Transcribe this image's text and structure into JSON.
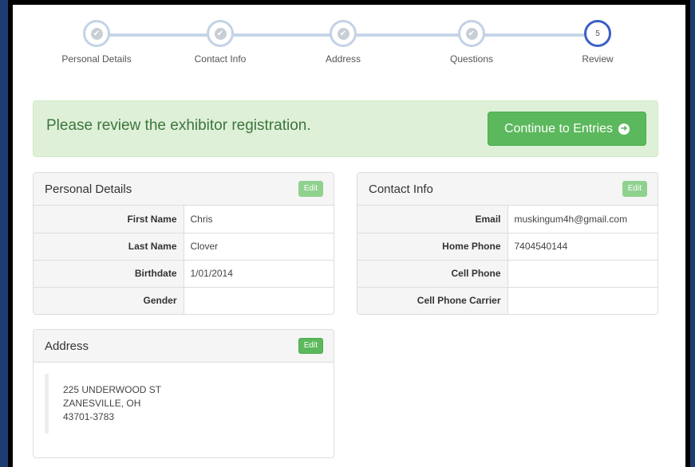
{
  "stepper": {
    "steps": [
      {
        "label": "Personal Details",
        "state": "done"
      },
      {
        "label": "Contact Info",
        "state": "done"
      },
      {
        "label": "Address",
        "state": "done"
      },
      {
        "label": "Questions",
        "state": "done"
      },
      {
        "label": "Review",
        "state": "current",
        "number": "5"
      }
    ],
    "check_glyph": "✔"
  },
  "alert": {
    "message": "Please review the exhibitor registration.",
    "continue_label": "Continue to Entries",
    "continue_icon": "arrow-circle-right-icon"
  },
  "personal": {
    "title": "Personal Details",
    "edit_label": "Edit",
    "rows": [
      {
        "label": "First Name",
        "value": "Chris"
      },
      {
        "label": "Last Name",
        "value": "Clover"
      },
      {
        "label": "Birthdate",
        "value": "1/01/2014"
      },
      {
        "label": "Gender",
        "value": ""
      }
    ]
  },
  "contact": {
    "title": "Contact Info",
    "edit_label": "Edit",
    "rows": [
      {
        "label": "Email",
        "value": "muskingum4h@gmail.com"
      },
      {
        "label": "Home Phone",
        "value": "7404540144"
      },
      {
        "label": "Cell Phone",
        "value": ""
      },
      {
        "label": "Cell Phone Carrier",
        "value": ""
      }
    ]
  },
  "address": {
    "title": "Address",
    "edit_label": "Edit",
    "line1": "225 UNDERWOOD ST",
    "line2": "ZANESVILLE, OH",
    "line3": "43701-3783"
  },
  "colors": {
    "success": "#5cb85c",
    "alert_bg": "#dff0d8",
    "alert_text": "#3c763d",
    "step_current": "#3b5fc4",
    "step_done": "#c3d2e6",
    "outer_bg": "#1d3d72"
  }
}
